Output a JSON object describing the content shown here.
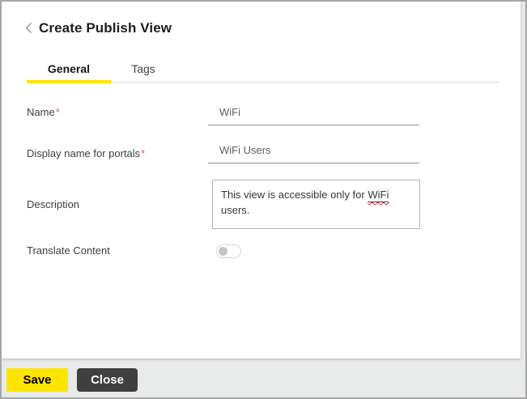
{
  "header": {
    "title": "Create Publish View"
  },
  "tabs": [
    {
      "label": "General",
      "active": true
    },
    {
      "label": "Tags",
      "active": false
    }
  ],
  "form": {
    "name": {
      "label": "Name",
      "required": "*",
      "value": "WiFi"
    },
    "display_name": {
      "label": "Display name for portals",
      "required": "*",
      "value": "WiFi Users"
    },
    "description": {
      "label": "Description",
      "value_before": "This view is accessible only for ",
      "misspelled_word": "WiFi",
      "value_after": " users."
    },
    "translate": {
      "label": "Translate Content",
      "state": "off"
    }
  },
  "footer": {
    "save_label": "Save",
    "close_label": "Close"
  },
  "colors": {
    "accent_yellow": "#fde500",
    "close_button_dark": "#3f3f3f",
    "required_red": "#e05c6d",
    "spellcheck_red": "#e02020"
  }
}
